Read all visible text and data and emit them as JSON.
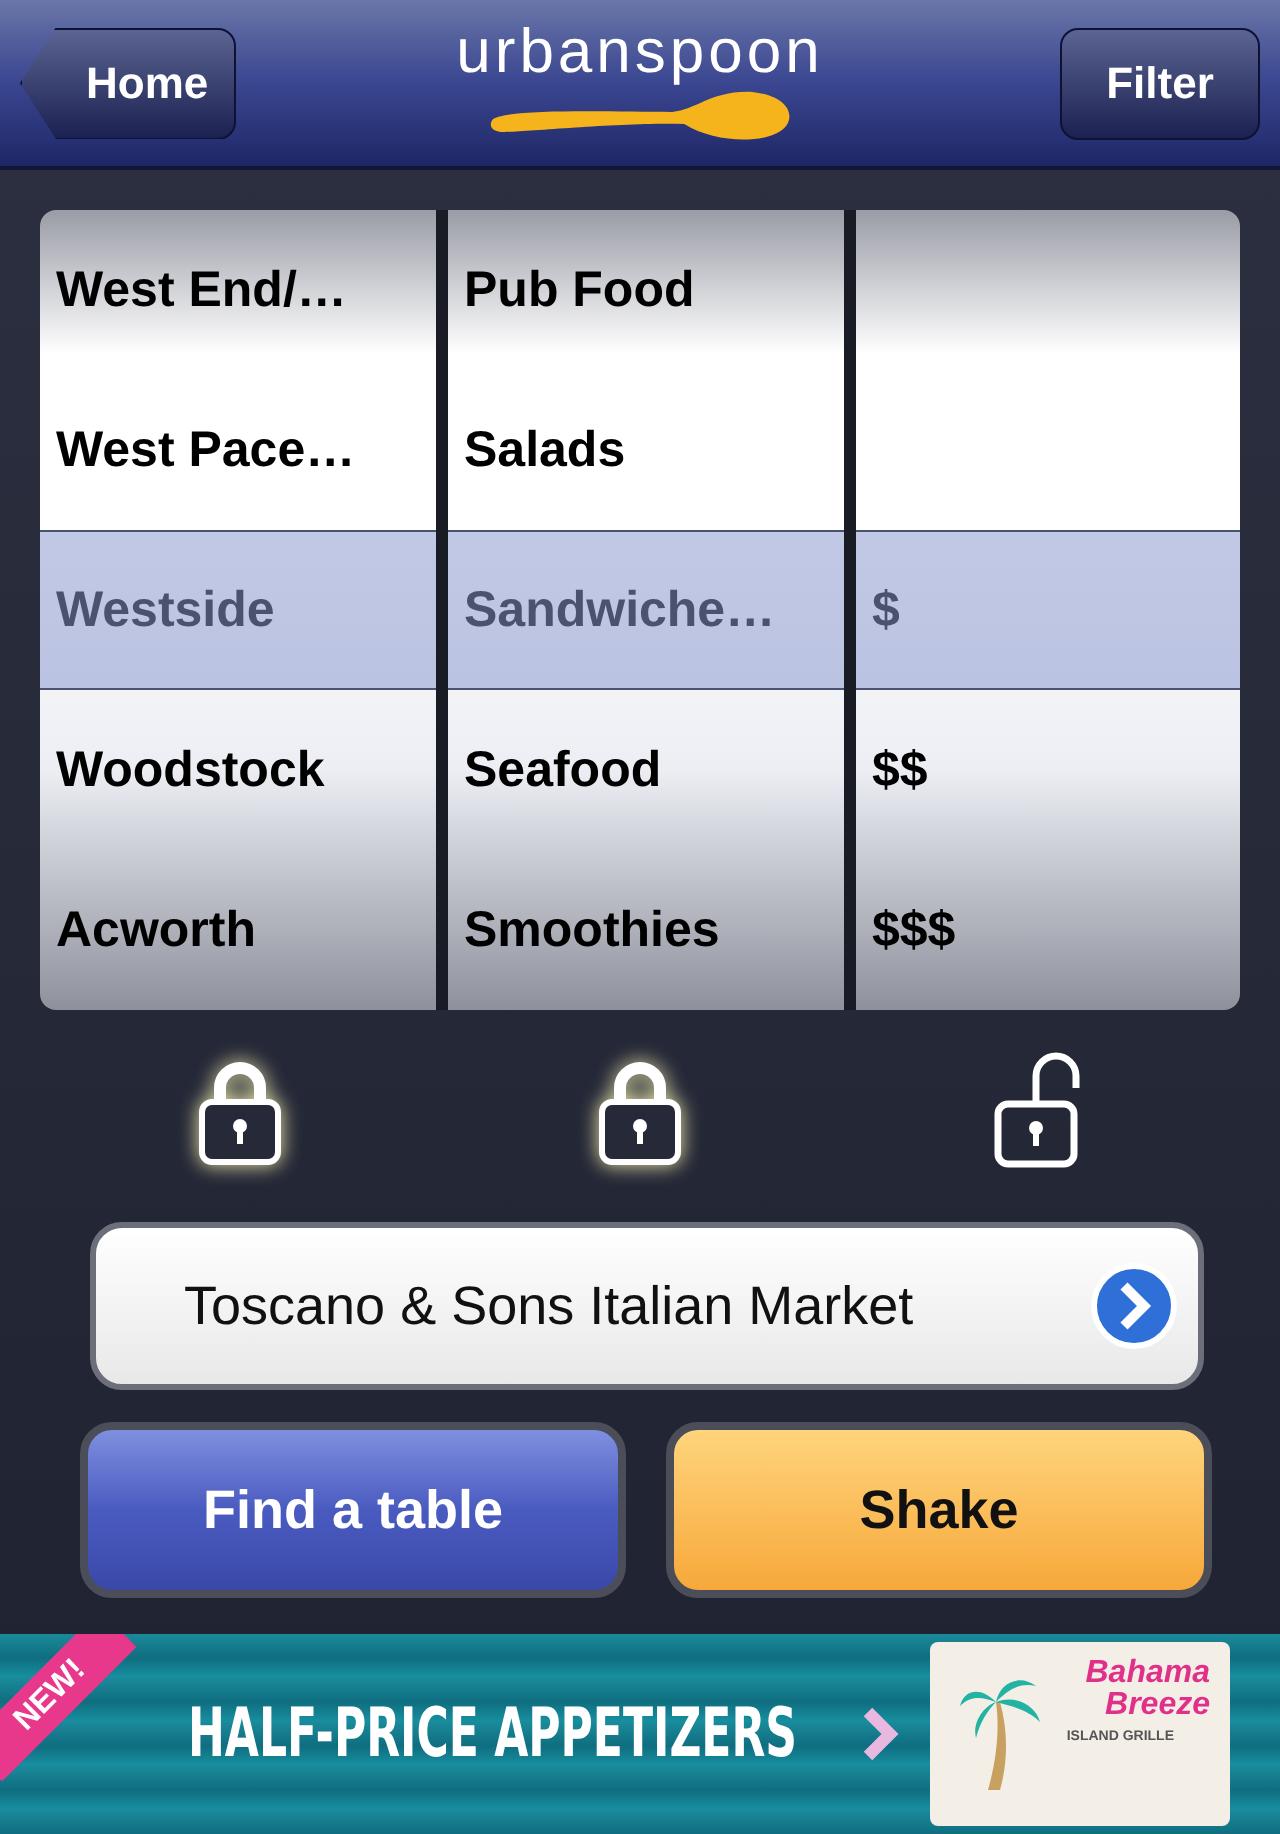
{
  "header": {
    "back_button": "Home",
    "logo": "urbanspoon",
    "filter_button": "Filter"
  },
  "wheels": [
    {
      "rows": [
        {
          "label": "West End/…",
          "selected": false
        },
        {
          "label": "West Pace…",
          "selected": false
        },
        {
          "label": "Westside",
          "selected": true
        },
        {
          "label": "Woodstock",
          "selected": false
        },
        {
          "label": "Acworth",
          "selected": false
        }
      ],
      "locked": true
    },
    {
      "rows": [
        {
          "label": "Pub Food",
          "selected": false
        },
        {
          "label": "Salads",
          "selected": false
        },
        {
          "label": "Sandwiche…",
          "selected": true
        },
        {
          "label": "Seafood",
          "selected": false
        },
        {
          "label": "Smoothies",
          "selected": false
        }
      ],
      "locked": true
    },
    {
      "rows": [
        {
          "label": "$",
          "selected": true
        },
        {
          "label": "$$",
          "selected": false
        },
        {
          "label": "$$$",
          "selected": false
        }
      ],
      "locked": false
    }
  ],
  "result": "Toscano & Sons Italian Market",
  "buttons": [
    {
      "label": "Find a table",
      "kind": "primary"
    },
    {
      "label": "Shake",
      "kind": "accent"
    }
  ],
  "banner": {
    "badge": "NEW!",
    "headline": "HALF-PRICE APPETIZERS",
    "brand_line_1": "Bahama",
    "brand_line_2": "Breeze",
    "brand_tagline": "ISLAND GRILLE"
  }
}
